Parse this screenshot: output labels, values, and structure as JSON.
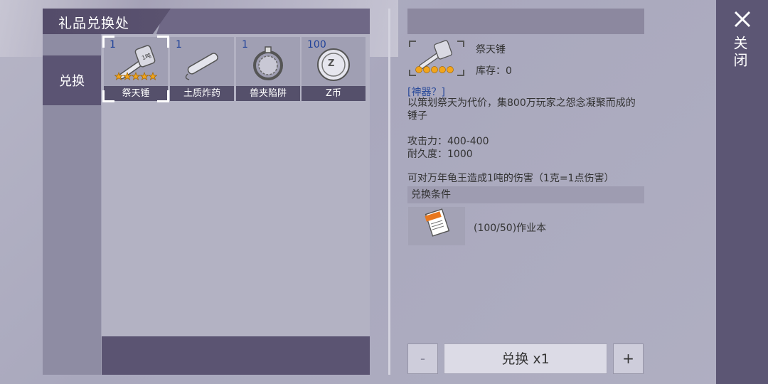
{
  "window": {
    "title": "礼品兑换处"
  },
  "sidebar": {
    "tab_label": "兑换"
  },
  "items": [
    {
      "name": "祭天锤",
      "count": "1",
      "stars": 5,
      "icon": "hammer-icon",
      "selected": true
    },
    {
      "name": "土质炸药",
      "count": "1",
      "icon": "dynamite-icon",
      "selected": false
    },
    {
      "name": "兽夹陷阱",
      "count": "1",
      "icon": "trap-icon",
      "selected": false
    },
    {
      "name": "Z币",
      "count": "100",
      "icon": "coin-icon",
      "selected": false
    }
  ],
  "detail": {
    "name": "祭天锤",
    "stock": "库存：0",
    "tag": "[神器？]",
    "description": "以策划祭天为代价，集800万玩家之怨念凝聚而成的锤子",
    "attack": "攻击力：400-400",
    "durability": "耐久度：1000",
    "effect": "可对万年龟王造成1吨的伤害（1克=1点伤害）",
    "condition_header": "兑换条件",
    "condition_text": "(100/50)作业本",
    "condition_icon": "notebook-icon"
  },
  "controls": {
    "minus": "-",
    "exchange": "兑换 x1",
    "plus": "+"
  },
  "close": {
    "label": "关闭"
  },
  "colors": {
    "accent": "#5c5674",
    "count_text": "#21439a",
    "tag_text": "#2a4a9a",
    "star": "#f2a51c"
  }
}
